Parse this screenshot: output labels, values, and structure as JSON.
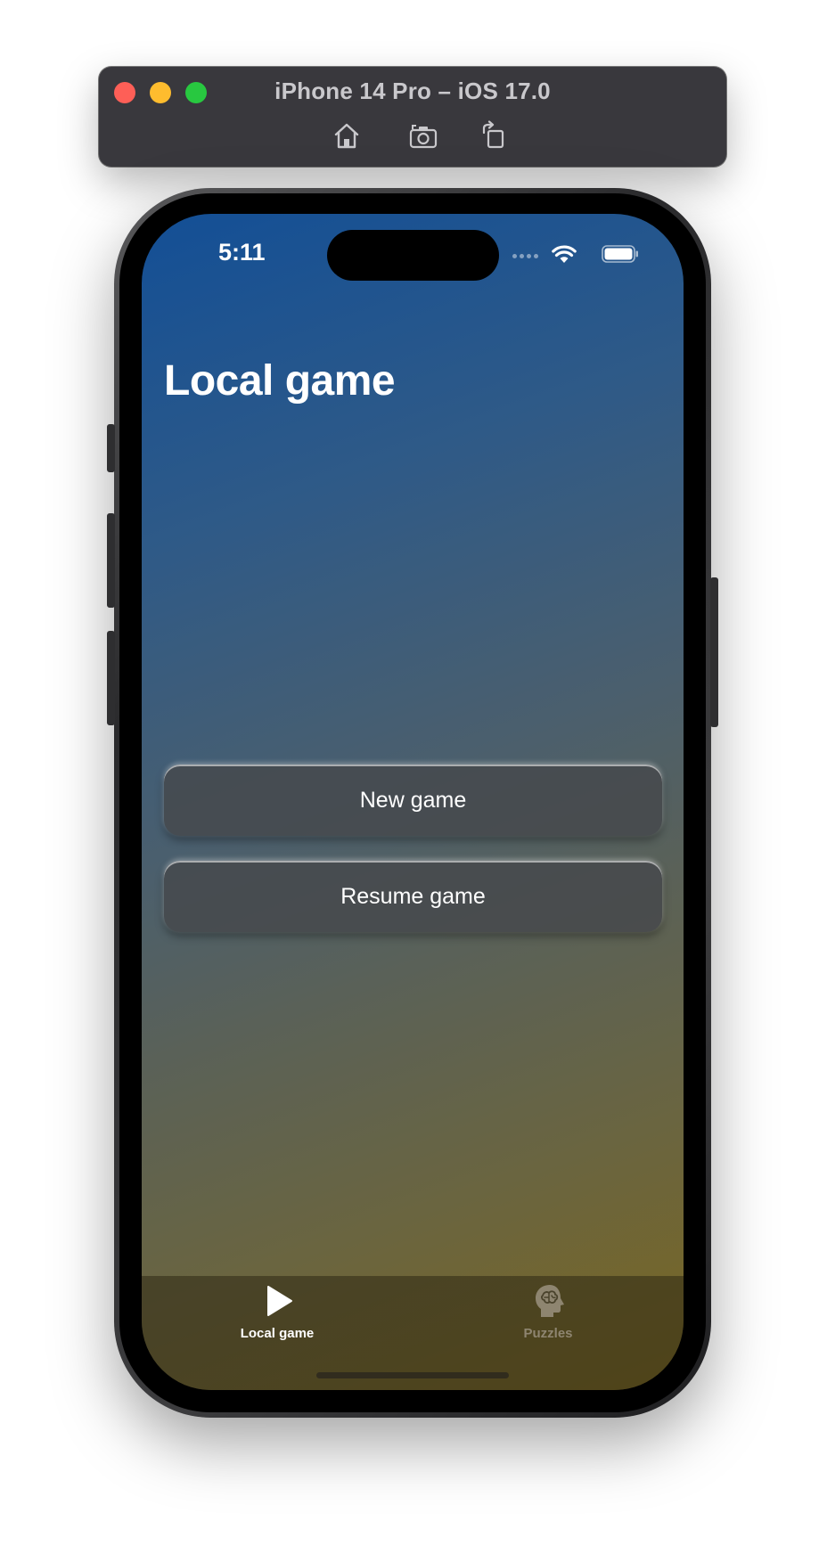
{
  "simulator": {
    "title": "iPhone 14 Pro – iOS 17.0",
    "tools": [
      {
        "icon": "home-icon"
      },
      {
        "icon": "screenshot-icon"
      },
      {
        "icon": "rotate-icon"
      }
    ]
  },
  "status_bar": {
    "time": "5:11"
  },
  "main": {
    "title": "Local game",
    "buttons": {
      "new_game": "New game",
      "resume_game": "Resume game"
    }
  },
  "tab_bar": {
    "items": [
      {
        "label": "Local game",
        "icon": "play-icon",
        "selected": true
      },
      {
        "label": "Puzzles",
        "icon": "brain-head-icon",
        "selected": false
      }
    ]
  },
  "colors": {
    "gradient_top": "#134f96",
    "gradient_bottom": "#7a6620",
    "tab_selected": "#ffffff",
    "tab_unselected": "#8e8570"
  }
}
